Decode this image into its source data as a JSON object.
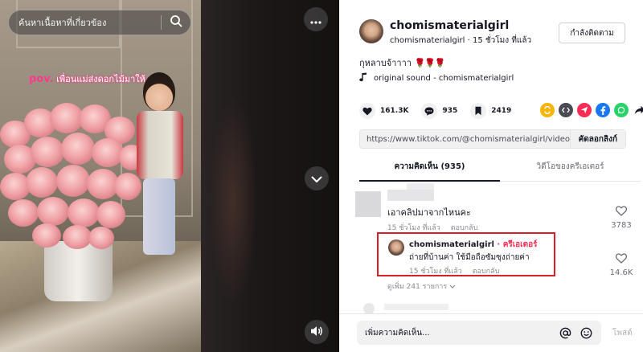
{
  "search": {
    "placeholder": "ค้นหาเนื้อหาที่เกี่ยวข้อง"
  },
  "video": {
    "overlay_pov": "pov.",
    "overlay_caption": "เพื่อนแม่ส่งดอกไม้มาให้"
  },
  "author": {
    "display_name": "chomismaterialgirl",
    "username": "chomismaterialgirl",
    "posted_ago": "15 ชั่วโมง ที่แล้ว",
    "follow_label": "กำลังติดตาม"
  },
  "post": {
    "caption_text": "กุหลาบจ้าาาา",
    "caption_emoji": "🌹🌹🌹",
    "sound": "original sound - chomismaterialgirl"
  },
  "actions": {
    "likes": "161.3K",
    "comments": "935",
    "saves": "2419"
  },
  "link": {
    "url": "https://www.tiktok.com/@chomismaterialgirl/video...",
    "copy_label": "คัดลอกลิงก์"
  },
  "tabs": [
    {
      "label": "ความคิดเห็น (935)"
    },
    {
      "label": "วิดีโอของครีเอเตอร์"
    }
  ],
  "comments": {
    "first": {
      "text": "เอาคลิปมาจากไหนคะ",
      "time": "15 ชั่วโมง ที่แล้ว",
      "reply_label": "ตอบกลับ",
      "likes": "3783"
    },
    "reply": {
      "author": "chomismaterialgirl",
      "badge": " · ครีเอเตอร์",
      "text": "ถ่ายที่บ้านค่า ใช้มือถือซัมซุงถ่ายค่า",
      "time": "15 ชั่วโมง ที่แล้ว",
      "reply_label": "ตอบกลับ",
      "likes": "14.6K"
    },
    "view_more": "ดูเพิ่ม 241 รายการ"
  },
  "comment_bar": {
    "placeholder": "เพิ่มความคิดเห็น...",
    "post_label": "โพสต์"
  },
  "colors": {
    "accent": "#fe2c55",
    "highlight_box": "#d61f26",
    "share_icons": [
      "#f7b500",
      "#4a4a52",
      "#fe2c55",
      "#1877f2",
      "#25d366",
      "#161823"
    ]
  }
}
